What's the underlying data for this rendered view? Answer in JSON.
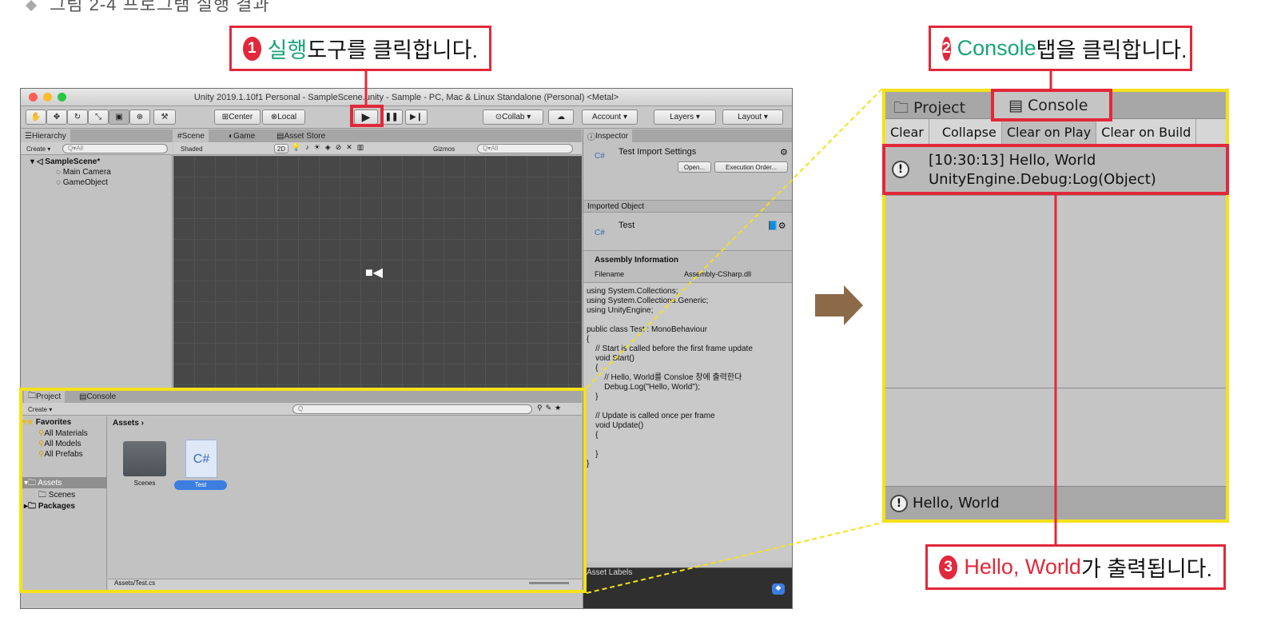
{
  "caption": "그림 2-4 프로그램 실행 결과",
  "callouts": {
    "c1": {
      "num": "1",
      "highlight": "실행",
      "rest": " 도구를 클릭합니다."
    },
    "c2": {
      "num": "2",
      "highlight": "Console",
      "rest": " 탭을 클릭합니다."
    },
    "c3": {
      "num": "3",
      "highlight": "Hello, World",
      "rest": "가 출력됩니다."
    }
  },
  "unity": {
    "title": "Unity 2019.1.10f1 Personal - SampleScene.unity - Sample - PC, Mac & Linux Standalone (Personal) <Metal>",
    "toolbar": {
      "pivot": "Center",
      "space": "Local",
      "collab": "Collab ▾",
      "account": "Account ▾",
      "layers": "Layers ▾",
      "layout": "Layout ▾"
    },
    "hierarchy": {
      "tab": "Hierarchy",
      "create": "Create ▾",
      "search": "Q▾All",
      "scene": "SampleScene*",
      "items": [
        "Main Camera",
        "GameObject"
      ]
    },
    "scene": {
      "tabs": [
        "Scene",
        "Game",
        "Asset Store"
      ],
      "shaded": "Shaded",
      "mode2d": "2D",
      "gizmos": "Gizmos",
      "search": "Q▾All"
    },
    "inspector": {
      "tab": "Inspector",
      "title": "Test Import Settings",
      "open": "Open...",
      "exec": "Execution Order...",
      "imported": "Imported Object",
      "objname": "Test",
      "assembly": "Assembly Information",
      "filename_label": "Filename",
      "filename": "Assembly-CSharp.dll",
      "code": "using System.Collections;\nusing System.Collections.Generic;\nusing UnityEngine;\n\npublic class Test : MonoBehaviour\n{\n    // Start is called before the first frame update\n    void Start()\n    {\n        // Hello, World를 Consloe 창에 출력한다\n        Debug.Log(\"Hello, World\");\n    }\n\n    // Update is called once per frame\n    void Update()\n    {\n\n    }\n}",
      "labels": "Asset Labels"
    },
    "project": {
      "tabs": [
        "Project",
        "Console"
      ],
      "create": "Create ▾",
      "search": "Q",
      "favorites": "Favorites",
      "fav_items": [
        "All Materials",
        "All Models",
        "All Prefabs"
      ],
      "assets": "Assets",
      "asset_children": [
        "Scenes"
      ],
      "packages": "Packages",
      "breadcrumb": "Assets ›",
      "files": [
        "Scenes",
        "Test"
      ],
      "path": "Assets/Test.cs"
    }
  },
  "console_zoom": {
    "tabs": [
      "Project",
      "Console"
    ],
    "buttons": [
      "Clear",
      "Collapse",
      "Clear on Play",
      "Clear on Build"
    ],
    "log_line1": "[10:30:13] Hello, World",
    "log_line2": "UnityEngine.Debug:Log(Object)",
    "status": "Hello, World"
  },
  "colors": {
    "accent_red": "#e2283a",
    "highlight_yellow": "#f4e11a",
    "arrow": "#8c6a48"
  }
}
